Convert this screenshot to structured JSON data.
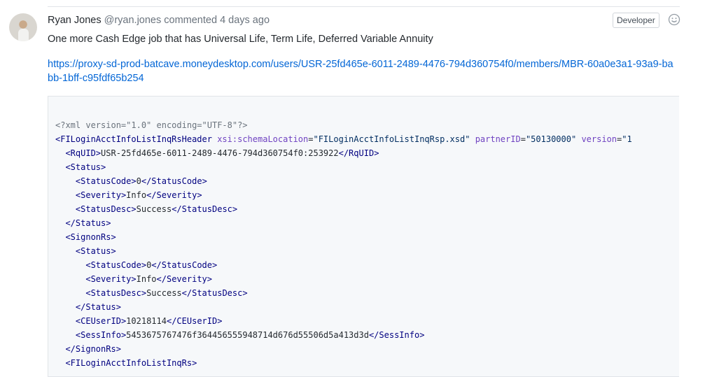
{
  "comment": {
    "author": "Ryan Jones",
    "handle": "@ryan.jones",
    "action": "commented",
    "time": "4 days ago",
    "badge": "Developer",
    "body": "One more Cash Edge job that has Universal Life, Term Life, Deferred Variable Annuity",
    "link": "https://proxy-sd-prod-batcave.moneydesktop.com/users/USR-25fd465e-6011-2489-4476-794d360754f0/members/MBR-60a0e3a1-93a9-babb-1bff-c95fdf65b254"
  },
  "code": {
    "lines": [
      "<?xml version=\"1.0\" encoding=\"UTF-8\"?>",
      "<FILoginAcctInfoListInqRsHeader xsi:schemaLocation=\"FILoginAcctInfoListInqRsp.xsd\" partnerID=\"50130000\" version=\"1",
      "  <RqUID>USR-25fd465e-6011-2489-4476-794d360754f0:253922</RqUID>",
      "  <Status>",
      "    <StatusCode>0</StatusCode>",
      "    <Severity>Info</Severity>",
      "    <StatusDesc>Success</StatusDesc>",
      "  </Status>",
      "  <SignonRs>",
      "    <Status>",
      "      <StatusCode>0</StatusCode>",
      "      <Severity>Info</Severity>",
      "      <StatusDesc>Success</StatusDesc>",
      "    </Status>",
      "    <CEUserID>10218114</CEUserID>",
      "    <SessInfo>5453675767476f364456555948714d676d55506d5a413d3d</SessInfo>",
      "  </SignonRs>",
      "  <FILoginAcctInfoListInqRs>"
    ]
  },
  "colors": {
    "link": "#0366d6",
    "tag": "#000080",
    "attr": "#6f42c1",
    "string": "#032f62"
  }
}
